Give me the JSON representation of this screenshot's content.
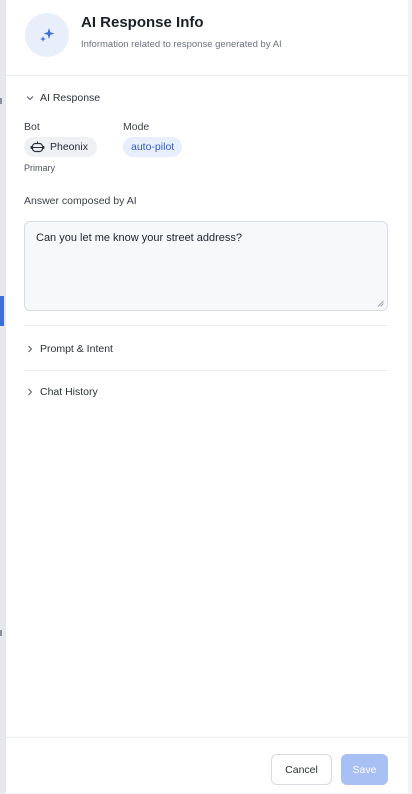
{
  "header": {
    "title": "AI Response Info",
    "subtitle": "Information related to response generated by AI"
  },
  "ai_response": {
    "section_label": "AI Response",
    "bot_label": "Bot",
    "bot_name": "Pheonix",
    "bot_role": "Primary",
    "mode_label": "Mode",
    "mode_value": "auto-pilot",
    "answer_label": "Answer composed by AI",
    "answer_text": "Can you let me know your street address?"
  },
  "sections": {
    "prompt_intent": "Prompt & Intent",
    "chat_history": "Chat History"
  },
  "footer": {
    "cancel_label": "Cancel",
    "save_label": "Save"
  },
  "colors": {
    "accent": "#2f5fd0",
    "save_disabled": "#a9c0f4",
    "badge_bg": "#e9eefb"
  },
  "icons": [
    "sparkle-icon",
    "chevron-down-icon",
    "bot-icon",
    "chevron-right-icon"
  ]
}
